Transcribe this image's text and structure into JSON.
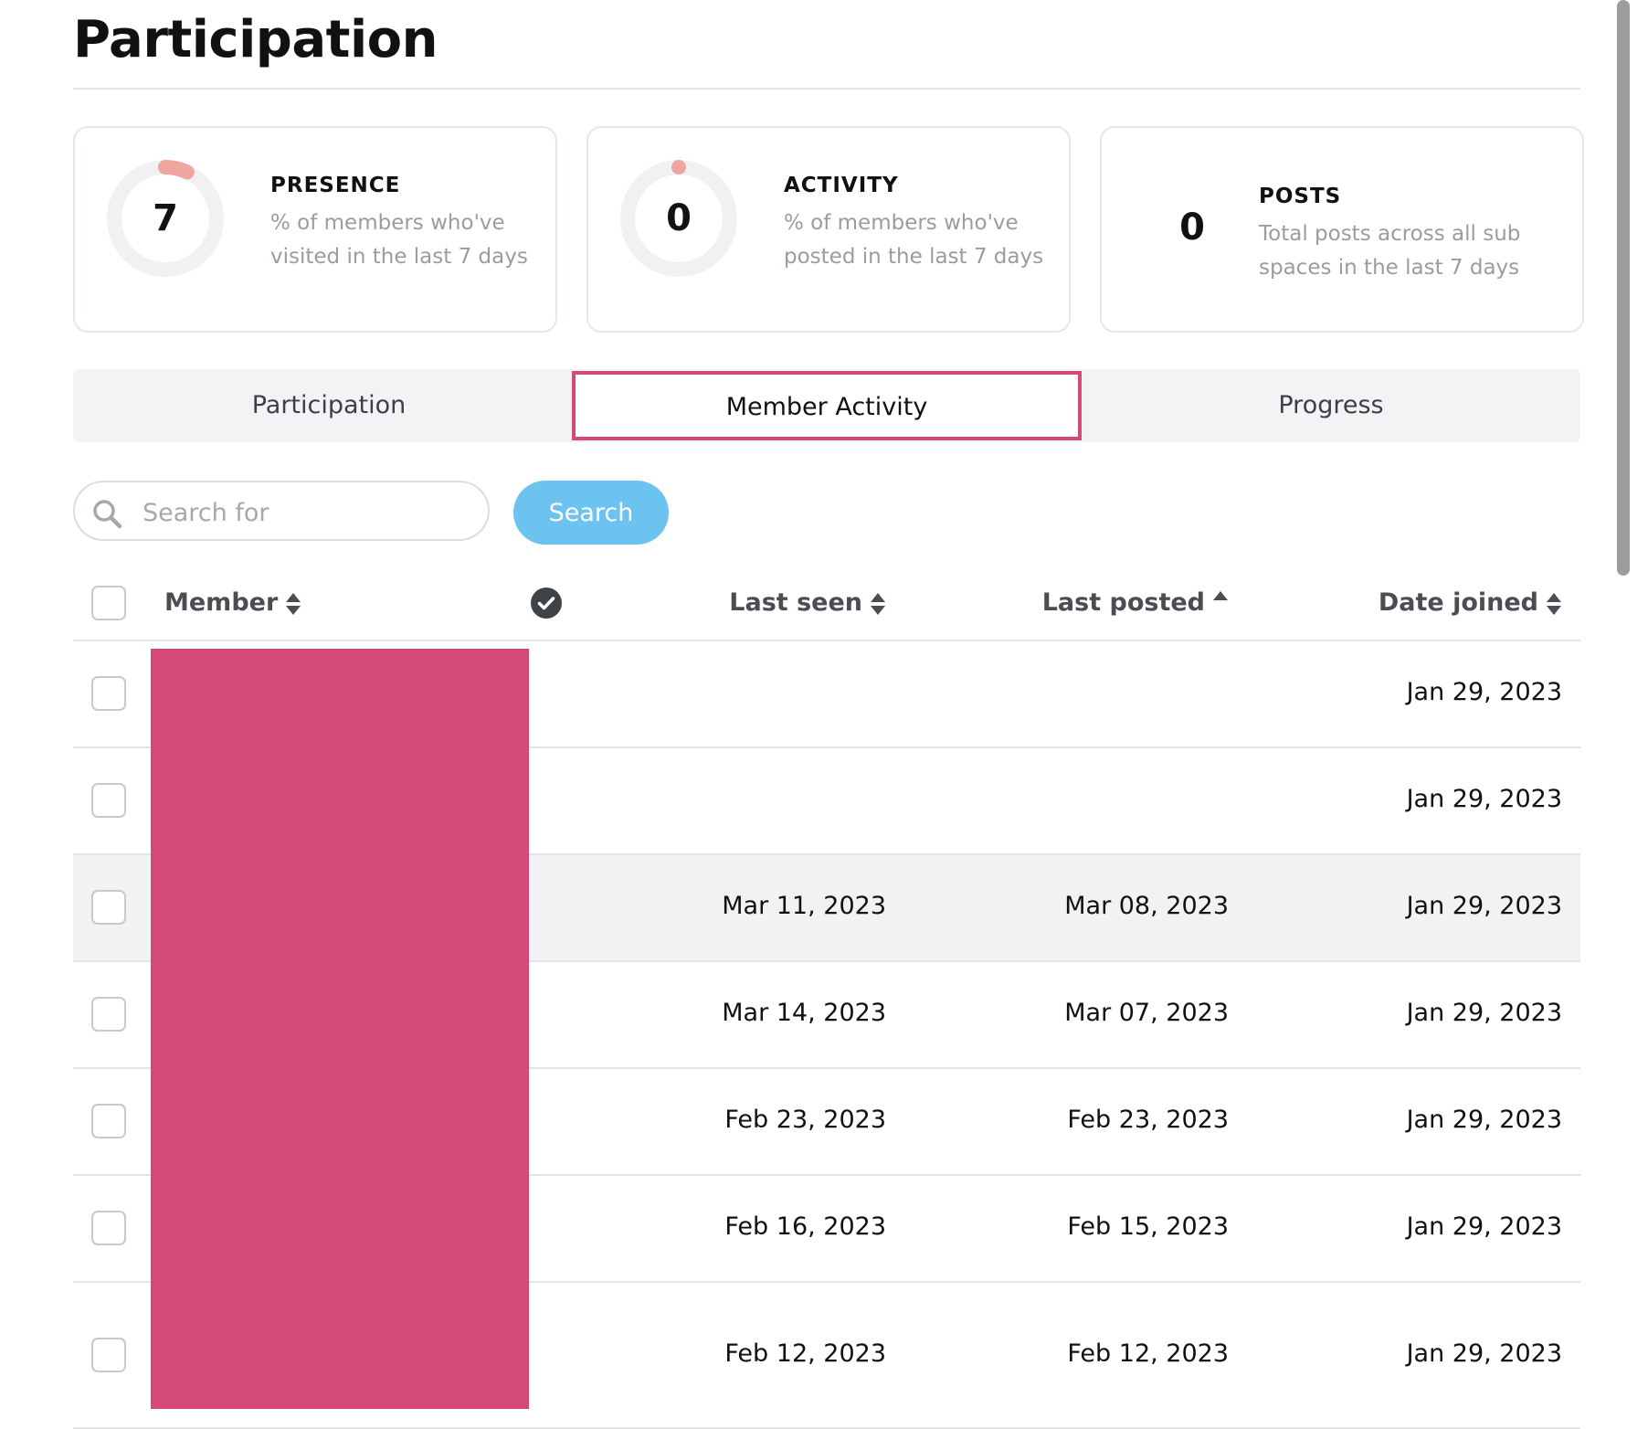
{
  "page": {
    "title": "Participation"
  },
  "stats": {
    "presence": {
      "value": "7",
      "label": "PRESENCE",
      "description": "% of members who've visited in the last 7 days",
      "percent": 7
    },
    "activity": {
      "value": "0",
      "label": "ACTIVITY",
      "description": "% of members who've posted in the last 7 days",
      "percent": 0
    },
    "posts": {
      "value": "0",
      "label": "POSTS",
      "description": "Total posts across all sub spaces in the last 7 days"
    }
  },
  "colors": {
    "ring_track": "#f1f1f2",
    "ring_fill": "#f0a5a0",
    "active_tab_border": "#d4497a",
    "search_button": "#6cc3f0",
    "redaction": "#d4497a"
  },
  "tabs": [
    {
      "label": "Participation",
      "active": false
    },
    {
      "label": "Member Activity",
      "active": true
    },
    {
      "label": "Progress",
      "active": false
    }
  ],
  "search": {
    "placeholder": "Search for",
    "value": "",
    "button_label": "Search"
  },
  "table": {
    "columns": {
      "member": "Member",
      "last_seen": "Last seen",
      "last_posted": "Last posted",
      "date_joined": "Date joined"
    },
    "sort": {
      "column": "last_posted",
      "direction": "ascending"
    },
    "rows": [
      {
        "last_seen": "",
        "last_posted": "",
        "date_joined": "Jan 29, 2023",
        "highlighted": false
      },
      {
        "last_seen": "",
        "last_posted": "",
        "date_joined": "Jan 29, 2023",
        "highlighted": false
      },
      {
        "last_seen": "Mar 11, 2023",
        "last_posted": "Mar 08, 2023",
        "date_joined": "Jan 29, 2023",
        "highlighted": true
      },
      {
        "last_seen": "Mar 14, 2023",
        "last_posted": "Mar 07, 2023",
        "date_joined": "Jan 29, 2023",
        "highlighted": false
      },
      {
        "last_seen": "Feb 23, 2023",
        "last_posted": "Feb 23, 2023",
        "date_joined": "Jan 29, 2023",
        "highlighted": false
      },
      {
        "last_seen": "Feb 16, 2023",
        "last_posted": "Feb 15, 2023",
        "date_joined": "Jan 29, 2023",
        "highlighted": false
      },
      {
        "last_seen": "Feb 12, 2023",
        "last_posted": "Feb 12, 2023",
        "date_joined": "Jan 29, 2023",
        "highlighted": false
      }
    ]
  },
  "icons": {
    "search": "search-icon",
    "sort_both": "sort-icon",
    "sort_up": "sort-up-icon",
    "verified": "check-circle-icon"
  }
}
